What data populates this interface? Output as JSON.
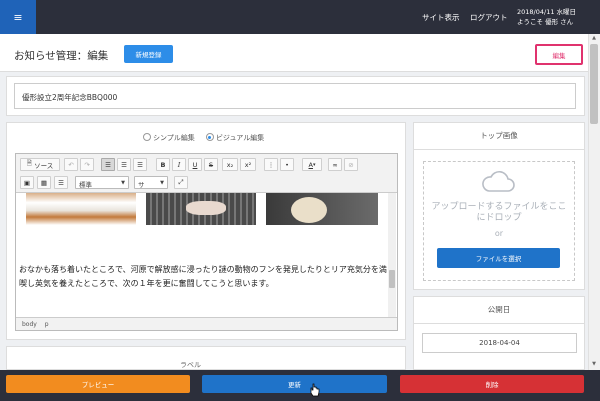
{
  "topbar": {
    "menu_icon": "hamburger-icon",
    "site_view": "サイト表示",
    "logout": "ログアウト",
    "date": "2018/04/11 水曜日",
    "welcome": "ようこそ 優形 さん"
  },
  "header": {
    "title": "お知らせ管理：編集",
    "new_button": "新規登録",
    "edit_button": "編集"
  },
  "form": {
    "title_value": "優形設立2周年記念BBQ000"
  },
  "editor": {
    "mode_simple": "シンプル編集",
    "mode_visual": "ビジュアル編集",
    "selected_mode": "ビジュアル編集",
    "toolbar": {
      "source": "ソース",
      "bold": "B",
      "italic": "I",
      "underline": "U",
      "strike": "S",
      "subscript": "x₂",
      "superscript": "x²",
      "text_color": "A",
      "format_select": "標準",
      "size_select": "サ"
    },
    "body_text": "おなかも落ち着いたところで、河原で解放感に浸ったり謎の動物のフンを発見したりとリア充気分を満喫し英気を養えたところで、次の１年を更に奮闘してこうと思います。",
    "status_path": "body p"
  },
  "label_section": {
    "title": "ラベル"
  },
  "sidebar": {
    "top_image": {
      "title": "トップ画像",
      "drop_text": "アップロードするファイルをここにドロップ",
      "or_text": "or",
      "select_button": "ファイルを選択"
    },
    "publish_date": {
      "title": "公開日",
      "value": "2018-04-04"
    }
  },
  "footer": {
    "preview": "プレビュー",
    "update": "更新",
    "delete": "削除"
  },
  "colors": {
    "topbar": "#2c2f3b",
    "primary": "#1f73c9",
    "accent_blue": "#2d8de8",
    "edit_pink": "#e0326e",
    "preview_orange": "#f28c1f",
    "delete_red": "#d63135"
  }
}
